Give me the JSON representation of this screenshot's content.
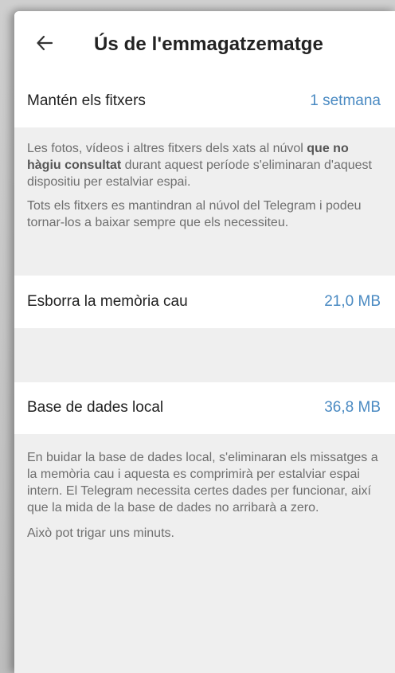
{
  "header": {
    "title": "Ús de l'emmagatzematge",
    "back_icon": "arrow-left-icon"
  },
  "keep_files": {
    "label": "Mantén els fitxers",
    "value": "1 setmana"
  },
  "keep_info": {
    "p1_start": "Les fotos, vídeos i altres fitxers dels xats al núvol ",
    "p1_bold": "que no hàgiu consultat",
    "p1_end": " durant aquest període s'eliminaran d'aquest dispositiu per estalviar espai.",
    "p2": "Tots els fitxers es mantindran al núvol del Telegram i podeu tornar-los a baixar sempre que els necessiteu."
  },
  "clear_cache": {
    "label": "Esborra la memòria cau",
    "value": "21,0 MB"
  },
  "local_db": {
    "label": "Base de dades local",
    "value": "36,8 MB"
  },
  "db_info": {
    "p1": "En buidar la base de dades local, s'eliminaran els missatges a la memòria cau i aquesta es comprimirà per estalviar espai intern. El Telegram necessita certes dades per funcionar, així que la mida de la base de dades no arribarà a zero.",
    "p2": "Això pot trigar uns minuts."
  },
  "colors": {
    "accent": "#4a8ac2",
    "background": "#efefef",
    "text": "#222222",
    "secondary_text": "#6e6e6e"
  }
}
